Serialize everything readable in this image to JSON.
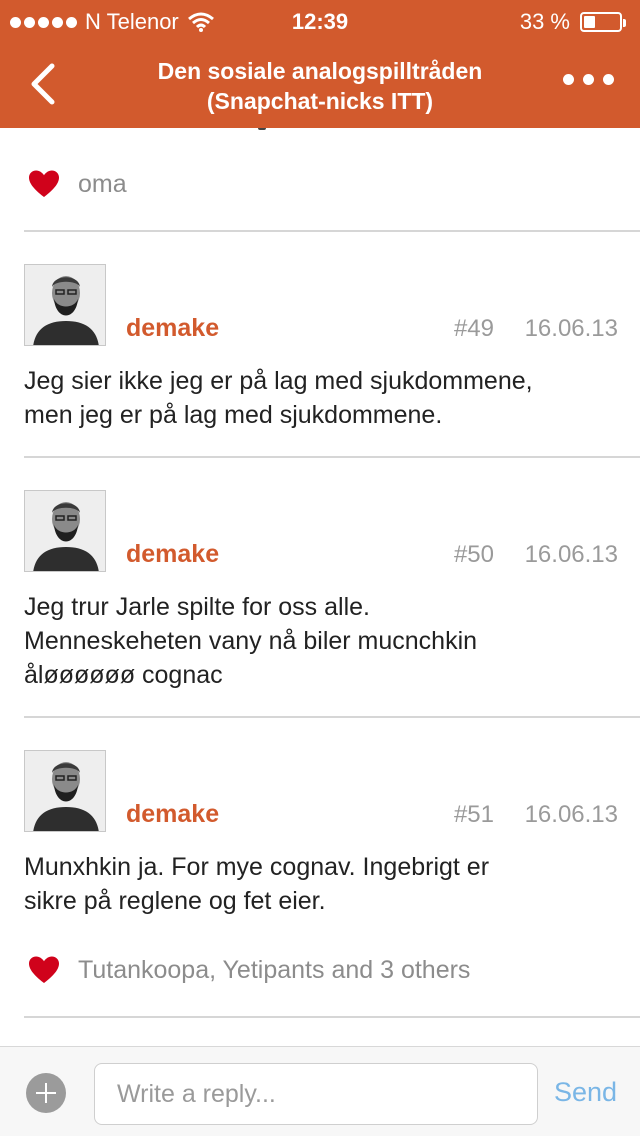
{
  "colors": {
    "accent": "#d25a2d",
    "heart": "#d0021b",
    "send": "#7ab6e6"
  },
  "status_bar": {
    "carrier": "N Telenor",
    "time": "12:39",
    "battery": "33 %",
    "battery_level": 0.33
  },
  "nav": {
    "title_line1": "Den sosiale analogspilltråden",
    "title_line2": "(Snapchat-nicks ITT)",
    "back_icon": "chevron-left-icon",
    "more_icon": "more-dots-icon"
  },
  "feed": {
    "top_likes": "oma",
    "posts": [
      {
        "author": "demake",
        "number": "#49",
        "date": "16.06.13",
        "body": "Jeg sier ikke jeg er på lag med sjukdommene,\nmen jeg er på lag med sjukdommene."
      },
      {
        "author": "demake",
        "number": "#50",
        "date": "16.06.13",
        "body": "Jeg trur Jarle spilte for oss alle.\nMenneskeheten vany nå biler mucnchkin\nåløøøøøø cognac"
      },
      {
        "author": "demake",
        "number": "#51",
        "date": "16.06.13",
        "body": "Munxhkin ja. For mye cognav. Ingebrigt er\nsikre på reglene og fet eier."
      }
    ],
    "bottom_likes": "Tutankoopa, Yetipants and 3 others"
  },
  "composer": {
    "placeholder": "Write a reply...",
    "value": "",
    "send_label": "Send"
  }
}
